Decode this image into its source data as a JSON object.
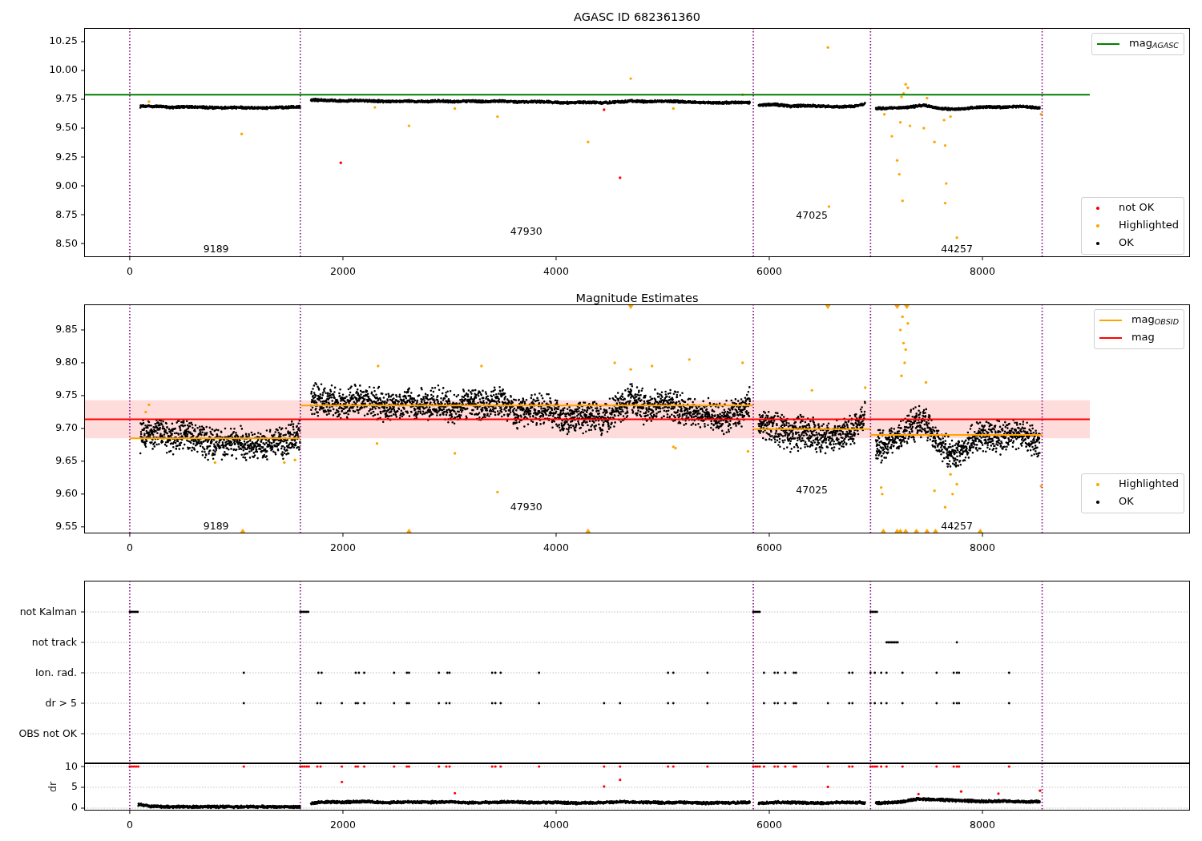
{
  "figure": {
    "panels": [
      {
        "title": "AGASC ID 682361360",
        "y_tick_labels": [
          "10.25",
          "10.00",
          "9.75",
          "9.50",
          "9.25",
          "9.00",
          "8.75",
          "8.50"
        ],
        "x_tick_labels": [
          "0",
          "2000",
          "4000",
          "6000",
          "8000"
        ],
        "obsid_labels": [
          "9189",
          "47930",
          "47025",
          "44257"
        ],
        "legends": [
          {
            "items": [
              {
                "label": "mag$_{AGASC}$",
                "kind": "line",
                "color": "#008000"
              }
            ]
          },
          {
            "items": [
              {
                "label": "not OK",
                "kind": "dot",
                "color": "#ff0000"
              },
              {
                "label": "Highlighted",
                "kind": "dot",
                "color": "#ffa500"
              },
              {
                "label": "OK",
                "kind": "dot",
                "color": "#000000"
              }
            ]
          }
        ]
      },
      {
        "title": "Magnitude Estimates",
        "y_tick_labels": [
          "9.85",
          "9.80",
          "9.75",
          "9.70",
          "9.65",
          "9.60",
          "9.55"
        ],
        "x_tick_labels": [
          "0",
          "2000",
          "4000",
          "6000",
          "8000"
        ],
        "obsid_labels": [
          "9189",
          "47930",
          "47025",
          "44257"
        ],
        "legends": [
          {
            "items": [
              {
                "label": "mag$_{OBSID}$",
                "kind": "line",
                "color": "#ffa500"
              },
              {
                "label": "mag",
                "kind": "line",
                "color": "#ff0000"
              }
            ]
          },
          {
            "items": [
              {
                "label": "Highlighted",
                "kind": "dot",
                "color": "#ffa500"
              },
              {
                "label": "OK",
                "kind": "dot",
                "color": "#000000"
              }
            ]
          }
        ]
      },
      {
        "flag_rows": [
          "not Kalman",
          "not track",
          "Ion. rad.",
          "dr > 5",
          "OBS not OK"
        ],
        "dr_axis": {
          "ylabel": "dr",
          "y_tick_labels": [
            "10",
            "5",
            "0"
          ],
          "x_tick_labels": [
            "0",
            "2000",
            "4000",
            "6000",
            "8000"
          ]
        }
      }
    ]
  }
}
